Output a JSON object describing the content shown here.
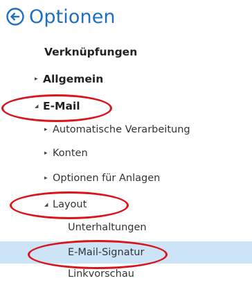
{
  "header": {
    "title": "Optionen",
    "back_icon": "back-arrow-circle-icon",
    "accent_color": "#1e6fbf"
  },
  "nav": {
    "shortcuts": {
      "label": "Verknüpfungen"
    },
    "general": {
      "label": "Allgemein",
      "expanded": false
    },
    "email": {
      "label": "E-Mail",
      "expanded": true,
      "children": {
        "auto_processing": {
          "label": "Automatische Verarbeitung",
          "expanded": false
        },
        "accounts": {
          "label": "Konten",
          "expanded": false
        },
        "attachments": {
          "label": "Optionen für Anlagen",
          "expanded": false
        },
        "layout": {
          "label": "Layout",
          "expanded": true,
          "children": {
            "conversations": {
              "label": "Unterhaltungen"
            },
            "signature": {
              "label": "E-Mail-Signatur",
              "selected": true
            },
            "link_preview": {
              "label": "Linkvorschau"
            }
          }
        }
      }
    }
  },
  "colors": {
    "selection": "#cde4f7",
    "annotation": "#d9141b",
    "text": "#333333"
  },
  "arrows": {
    "collapsed": "▸",
    "expanded": "◢"
  }
}
